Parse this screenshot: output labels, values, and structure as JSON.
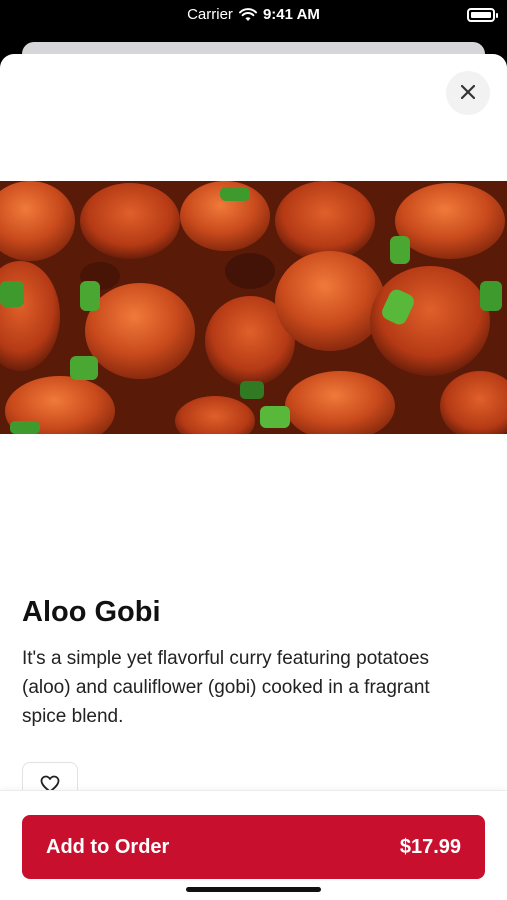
{
  "status_bar": {
    "carrier": "Carrier",
    "time": "9:41 AM"
  },
  "icons": {
    "close": "close-icon",
    "favorite": "heart-icon",
    "wifi": "wifi-icon",
    "battery": "battery-icon"
  },
  "dish": {
    "name": "Aloo Gobi",
    "description": "It's a simple yet flavorful curry featuring potatoes (aloo) and cauliflower (gobi) cooked in a fragrant spice blend.",
    "image": "dish-photo"
  },
  "order": {
    "label": "Add to Order",
    "price": "$17.99"
  },
  "colors": {
    "accent": "#c8102e"
  }
}
